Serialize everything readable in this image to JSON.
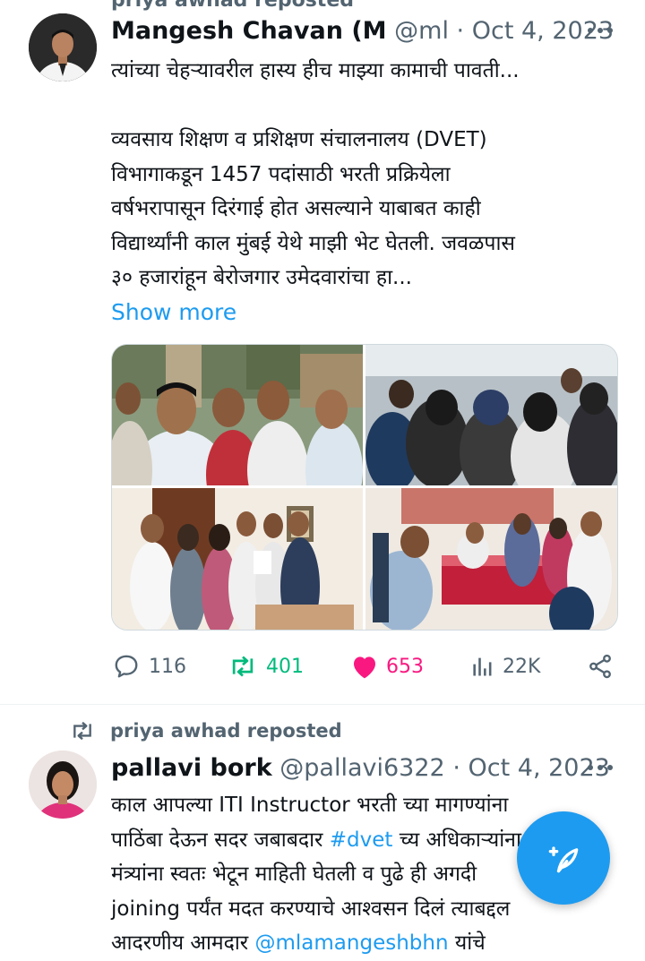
{
  "top_partial": {
    "text": "priya awhad reposted"
  },
  "tweet1": {
    "author_name": "Mangesh Chavan (M",
    "handle": "@ml",
    "separator": "·",
    "date": "Oct 4, 2023",
    "lines": [
      "त्यांच्या चेहऱ्यावरील हास्य हीच माझ्या कामाची पावती...",
      "",
      "व्यवसाय शिक्षण व प्रशिक्षण संचालनालय (DVET)",
      "विभागाकडून 1457 पदांसाठी भरती प्रक्रियेला",
      "वर्षभरापासून दिरंगाई होत असल्याने याबाबत काही",
      "विद्यार्थ्यांनी काल मुंबई येथे माझी भेट घेतली. जवळपास",
      "३० हजारांहून बेरोजगार उमेदवारांचा हा..."
    ],
    "show_more": "Show more",
    "stats": {
      "replies": "116",
      "reposts": "401",
      "likes": "653",
      "views": "22K"
    }
  },
  "repost_banner": {
    "text": "priya awhad reposted"
  },
  "tweet2": {
    "author_name": "pallavi bork",
    "handle": "@pallavi6322",
    "separator": "·",
    "date": "Oct 4, 2023",
    "line1": "काल आपल्या ITI Instructor भरती च्या मागण्यांना",
    "line2_pre": "पाठिंबा देऊन सदर जबाबदार ",
    "line2_hashtag": "#dvet",
    "line2_post": " च्य अधिकाऱ्यांना",
    "line3": "मंत्र्यांना स्वतः भेटून माहिती घेतली व पुढे ही अगदी",
    "line4": "joining पर्यंत मदत करण्याचे आश्वसन दिलं त्याबद्दल",
    "line5_pre": "आदरणीय आमदार ",
    "line5_mention": "@mlamangeshbhn",
    "line5_post": " यांचे"
  },
  "colors": {
    "text": "#0f1419",
    "secondary": "#536471",
    "link": "#1d9bf0",
    "repost_green": "#00ba7c",
    "like_pink": "#f91880",
    "fab": "#1d9bf0"
  },
  "icons": {
    "more": "more-horizontal-icon",
    "reply": "reply-icon",
    "repost": "repost-icon",
    "like": "heart-filled-icon",
    "views": "views-chart-icon",
    "share": "share-icon",
    "compose": "compose-feather-icon"
  }
}
